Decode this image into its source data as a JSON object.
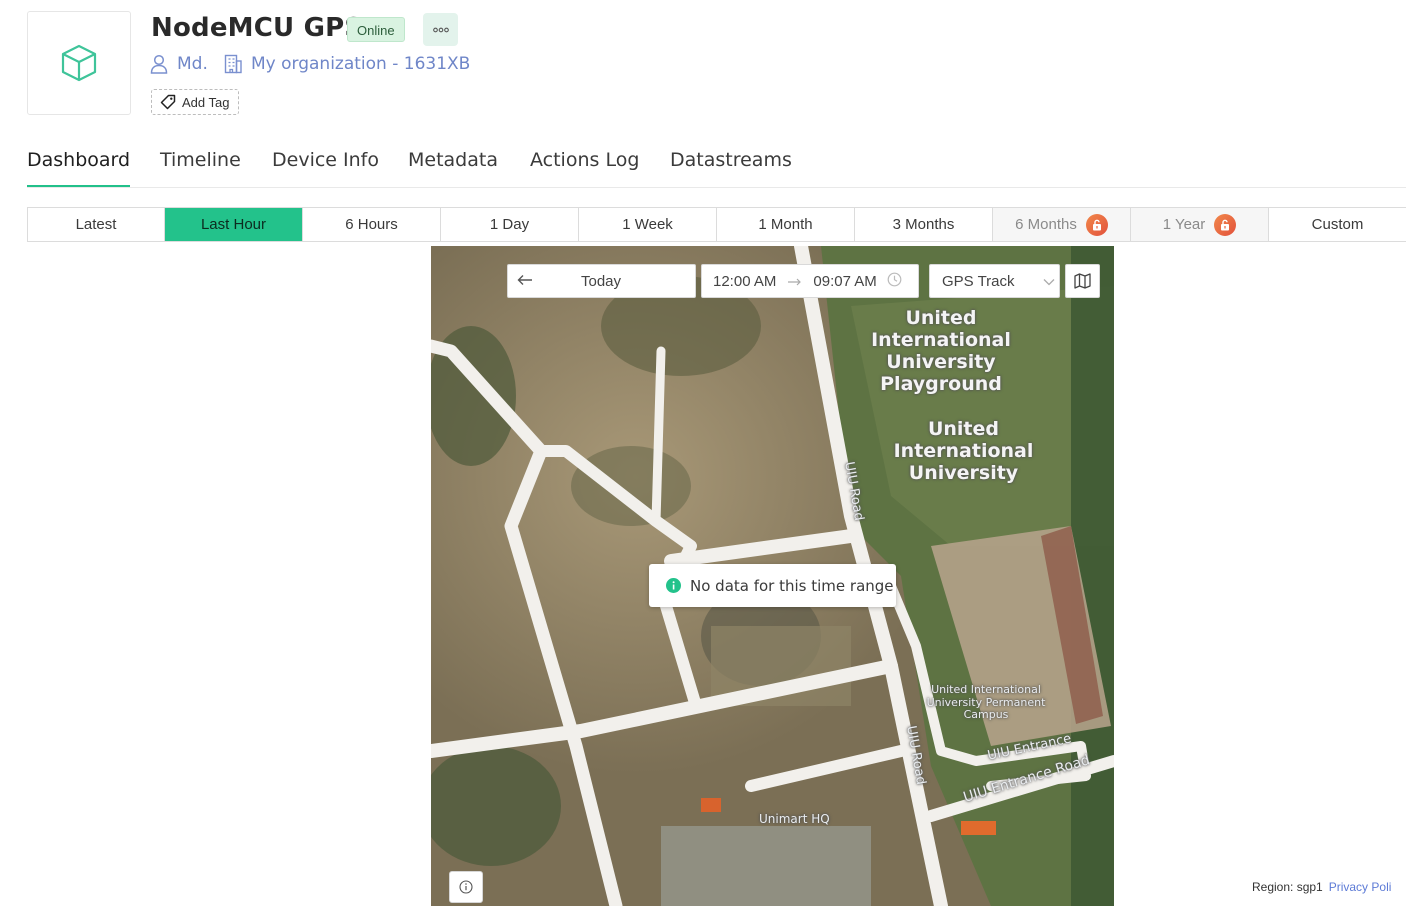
{
  "device": {
    "name": "NodeMCU GPS",
    "status": "Online",
    "owner": "Md.",
    "organization": "My organization - 1631XB",
    "add_tag_label": "Add Tag",
    "icon": "cube-icon"
  },
  "tabs": [
    {
      "label": "Dashboard",
      "active": true
    },
    {
      "label": "Timeline"
    },
    {
      "label": "Device Info"
    },
    {
      "label": "Metadata"
    },
    {
      "label": "Actions Log"
    },
    {
      "label": "Datastreams"
    }
  ],
  "time_ranges": [
    {
      "label": "Latest"
    },
    {
      "label": "Last Hour",
      "active": true
    },
    {
      "label": "6 Hours"
    },
    {
      "label": "1 Day"
    },
    {
      "label": "1 Week"
    },
    {
      "label": "1 Month"
    },
    {
      "label": "3 Months"
    },
    {
      "label": "6 Months",
      "locked": true
    },
    {
      "label": "1 Year",
      "locked": true
    },
    {
      "label": "Custom"
    }
  ],
  "map": {
    "date_label": "Today",
    "start_time": "12:00 AM",
    "end_time": "09:07 AM",
    "layer_select": "GPS Track",
    "empty_message": "No data for this time range",
    "labels": {
      "playground": "United International University Playground",
      "university": "United International University",
      "uiu_road": "UIU Road",
      "uiu_road_2": "UIU Road",
      "permanent_campus": "United International University Permanent Campus",
      "uiu_entrance": "UIU Entrance",
      "uiu_entrance_road": "UIU Entrance Road",
      "unimart": "Unimart HQ"
    }
  },
  "footer": {
    "region": "Region: sgp1",
    "privacy": "Privacy Poli"
  },
  "colors": {
    "accent": "#23c28b",
    "link": "#6f86c8",
    "lock_badge": "#e9603f"
  }
}
